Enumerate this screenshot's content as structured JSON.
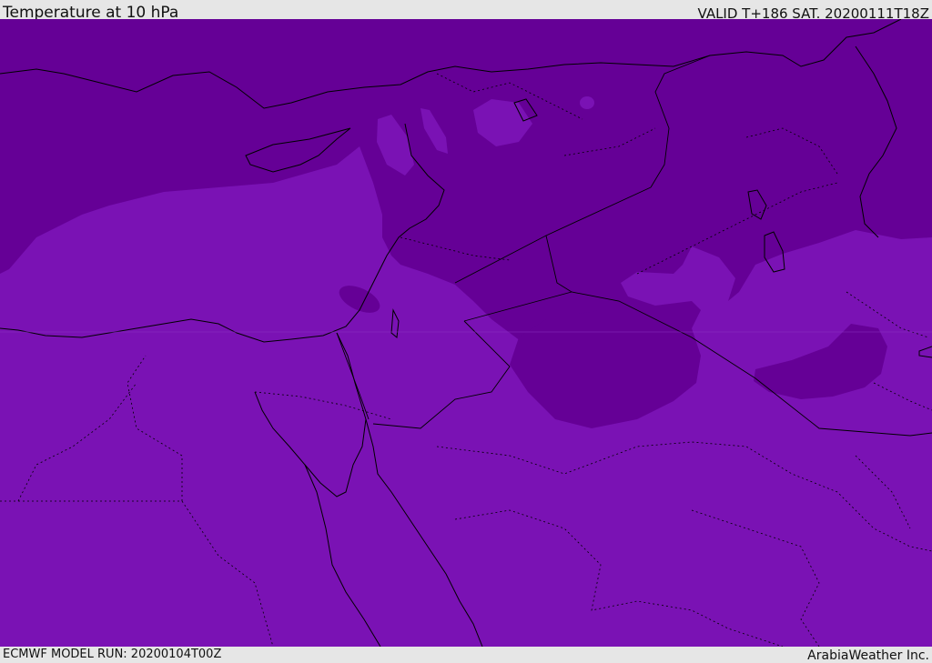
{
  "header": {
    "title": "Temperature at 10 hPa",
    "valid": "VALID T+186 SAT. 20200111T18Z"
  },
  "footer": {
    "model_run": "ECMWF MODEL RUN: 20200104T00Z",
    "credit": "ArabiaWeather Inc."
  },
  "map": {
    "colors": {
      "cold_band": "#650096",
      "mid_band": "#7a12b4",
      "coastline": "#000000"
    }
  }
}
